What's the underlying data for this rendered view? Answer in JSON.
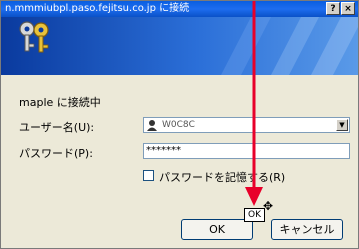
{
  "window": {
    "title": "n.mmmiubpl.paso.fejitsu.co.jp に接続",
    "help_glyph": "?",
    "close_glyph": "×"
  },
  "banner": {
    "keys_icon": "keys-icon"
  },
  "connecting": {
    "text": "maple に接続中"
  },
  "form": {
    "user_label": "ユーザー名(U):",
    "user_value": "W0C8C",
    "user_dropdown_glyph": "▼",
    "pass_label": "パスワード(P):",
    "pass_value": "*******",
    "remember_label": "パスワードを記憶する(R)"
  },
  "buttons": {
    "ok": "OK",
    "cancel": "キャンセル"
  },
  "overlay": {
    "ok_tooltip": "OK",
    "cursor_glyph": "✥",
    "arrow_color": "#e8002a"
  }
}
